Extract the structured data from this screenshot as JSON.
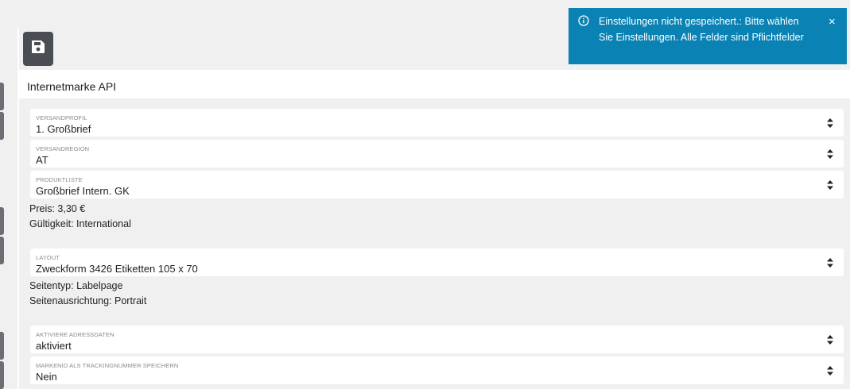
{
  "toolbar": {
    "save_icon": "floppy-disk-icon"
  },
  "header": {
    "title": "Internetmarke API"
  },
  "fields": {
    "versandprofil": {
      "label": "VERSANDPROFIL",
      "value": "1. Großbrief"
    },
    "versandregion": {
      "label": "VERSANDREGION",
      "value": "AT"
    },
    "produktliste": {
      "label": "PRODUKTLISTE",
      "value": "Großbrief Intern. GK"
    },
    "layout": {
      "label": "LAYOUT",
      "value": "Zweckform 3426 Etiketten 105 x 70"
    },
    "adressdaten": {
      "label": "AKTIVIERE ADRESSDATEN",
      "value": "aktiviert"
    },
    "tracking": {
      "label": "MARKENID ALS TRACKINGNUMMER SPEICHERN",
      "value": "Nein"
    }
  },
  "product_info": {
    "preis": "Preis: 3,30 €",
    "gueltigkeit": "Gültigkeit: International"
  },
  "layout_info": {
    "seitentyp": "Seitentyp: Labelpage",
    "ausrichtung": "Seitenausrichtung: Portrait"
  },
  "toast": {
    "icon": "info-icon",
    "message": "Einstellungen nicht gespeichert.: Bitte wählen Sie Einstellungen. Alle Felder sind Pflichtfelder",
    "close": "×",
    "background": "#0a82b4"
  },
  "colors": {
    "button_dark": "#4a4e54",
    "page_bg": "#f0f0f0"
  }
}
